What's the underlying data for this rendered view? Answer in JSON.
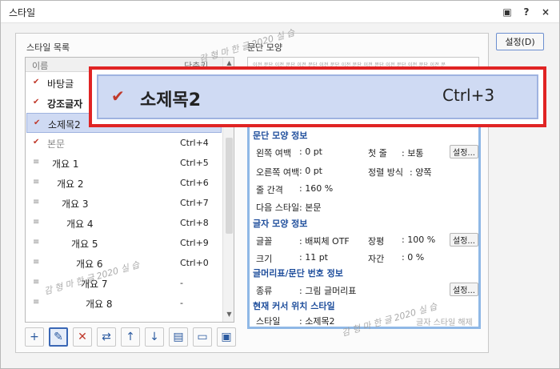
{
  "window": {
    "title": "스타일",
    "controls": [
      "▣",
      "?",
      "×"
    ]
  },
  "left": {
    "list_label": "스타일 목록",
    "col_name": "이름",
    "col_key": "단축키",
    "rows": [
      {
        "name": "바탕글",
        "key": "",
        "icon": "style",
        "indent": 0,
        "weight": "normal",
        "color": "#222222"
      },
      {
        "name": "강조글자",
        "key": "",
        "icon": "style",
        "indent": 0,
        "weight": "bold",
        "color": "#222222"
      },
      {
        "name": "소제목2",
        "key": "Ctrl+3",
        "icon": "style",
        "indent": 0,
        "weight": "normal",
        "color": "#222222"
      },
      {
        "name": "본문",
        "key": "Ctrl+4",
        "icon": "style",
        "indent": 0,
        "weight": "normal",
        "color": "#8a8a8a"
      },
      {
        "name": "개요 1",
        "key": "Ctrl+5",
        "icon": "outline",
        "indent": 1,
        "weight": "normal",
        "color": "#222222"
      },
      {
        "name": "개요 2",
        "key": "Ctrl+6",
        "icon": "outline",
        "indent": 2,
        "weight": "normal",
        "color": "#222222"
      },
      {
        "name": "개요 3",
        "key": "Ctrl+7",
        "icon": "outline",
        "indent": 3,
        "weight": "normal",
        "color": "#222222"
      },
      {
        "name": "개요 4",
        "key": "Ctrl+8",
        "icon": "outline",
        "indent": 4,
        "weight": "normal",
        "color": "#222222"
      },
      {
        "name": "개요 5",
        "key": "Ctrl+9",
        "icon": "outline",
        "indent": 5,
        "weight": "normal",
        "color": "#222222"
      },
      {
        "name": "개요 6",
        "key": "Ctrl+0",
        "icon": "outline",
        "indent": 6,
        "weight": "normal",
        "color": "#222222"
      },
      {
        "name": "개요 7",
        "key": "-",
        "icon": "outline",
        "indent": 7,
        "weight": "normal",
        "color": "#222222"
      },
      {
        "name": "개요 8",
        "key": "-",
        "icon": "outline",
        "indent": 8,
        "weight": "normal",
        "color": "#222222"
      }
    ],
    "selected_index": 2
  },
  "right": {
    "para_label": "문단 모양",
    "preview_text": "이전 문단 이전 문단 이전 문단 이전 문단 이전 문단 이전 문단 이전 문단 이전 문단 이전 문",
    "sections": {
      "para": "문단 모양 정보",
      "char": "글자 모양 정보",
      "bullet": "글머리표/문단 번호 정보",
      "cursor": "현재 커서 위치 스타일"
    },
    "fields": {
      "left_margin_label": "왼쪽 여백",
      "left_margin": ": 0 pt",
      "first_line_label": "첫 줄",
      "first_line": ": 보통",
      "right_margin_label": "오른쪽 여백",
      "right_margin": ": 0 pt",
      "align_label": "정렬 방식",
      "align": ": 양쪽",
      "line_spacing_label": "줄 간격",
      "line_spacing": ": 160 %",
      "next_style_label": "다음 스타일",
      "next_style": ": 본문",
      "font_label": "글꼴",
      "font": ": 배찌체 OTF",
      "width_label": "장평",
      "width": ": 100 %",
      "size_label": "크기",
      "size": ": 11 pt",
      "spacing_label": "자간",
      "spacing": ": 0 %",
      "kind_label": "종류",
      "kind": ": 그림 글머리표",
      "style_label": "스타일",
      "style": ": 소제목2"
    },
    "setup_button": "설정...",
    "release_char_style": "글자 스타일 해제"
  },
  "buttons": {
    "settings": "설정(D)"
  },
  "toolbar": [
    {
      "name": "add-style-button",
      "glyph": "+"
    },
    {
      "name": "edit-style-button",
      "glyph": "✎"
    },
    {
      "name": "delete-style-button",
      "glyph": "✕"
    },
    {
      "name": "replace-style-button",
      "glyph": "⇄"
    },
    {
      "name": "move-up-button",
      "glyph": "↑"
    },
    {
      "name": "move-down-button",
      "glyph": "↓"
    },
    {
      "name": "import-style-button",
      "glyph": "▤"
    },
    {
      "name": "open-style-button",
      "glyph": "▭"
    },
    {
      "name": "save-style-button",
      "glyph": "▣"
    }
  ],
  "watermark": "감 형 마 한 글 2020 실 습",
  "zoom": {
    "name": "소제목2",
    "key": "Ctrl+3"
  }
}
